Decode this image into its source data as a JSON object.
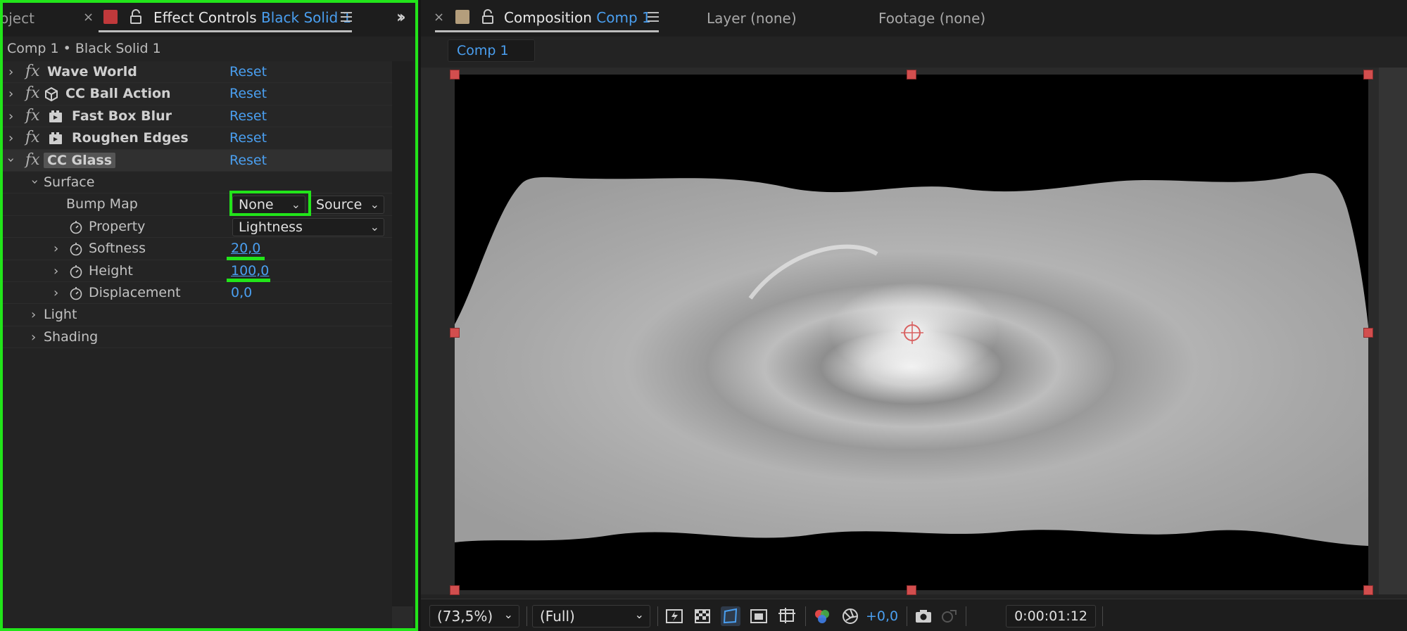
{
  "left_panel": {
    "project_tab": "oject",
    "effect_controls_tab": {
      "label": "Effect Controls",
      "layer": "Black Solid 1",
      "chip_color": "#c0393b"
    },
    "breadcrumb": "Comp 1 • Black Solid 1",
    "effects": [
      {
        "name": "Wave World",
        "reset": "Reset"
      },
      {
        "name": "CC Ball Action",
        "reset": "Reset"
      },
      {
        "name": "Fast Box Blur",
        "reset": "Reset"
      },
      {
        "name": "Roughen Edges",
        "reset": "Reset"
      },
      {
        "name": "CC Glass",
        "reset": "Reset"
      }
    ],
    "surface": {
      "group": "Surface",
      "bump_map_label": "Bump Map",
      "bump_map_value": "None",
      "bump_map_source": "Source",
      "property_label": "Property",
      "property_value": "Lightness",
      "softness_label": "Softness",
      "softness_value": "20,0",
      "height_label": "Height",
      "height_value": "100,0",
      "displacement_label": "Displacement",
      "displacement_value": "0,0"
    },
    "light_group": "Light",
    "shading_group": "Shading"
  },
  "right_panel": {
    "composition_tab": {
      "label": "Composition",
      "comp": "Comp 1",
      "chip_color": "#b49e7c"
    },
    "layer_tab": "Layer (none)",
    "footage_tab": "Footage (none)",
    "comp_button": "Comp 1",
    "zoom": "(73,5%)",
    "resolution": "(Full)",
    "exposure": "+0,0",
    "timecode": "0:00:01:12"
  },
  "colors": {
    "accent_blue": "#4a9ff0",
    "highlight_green": "#22e51a",
    "handle_red": "#d24e4e"
  }
}
